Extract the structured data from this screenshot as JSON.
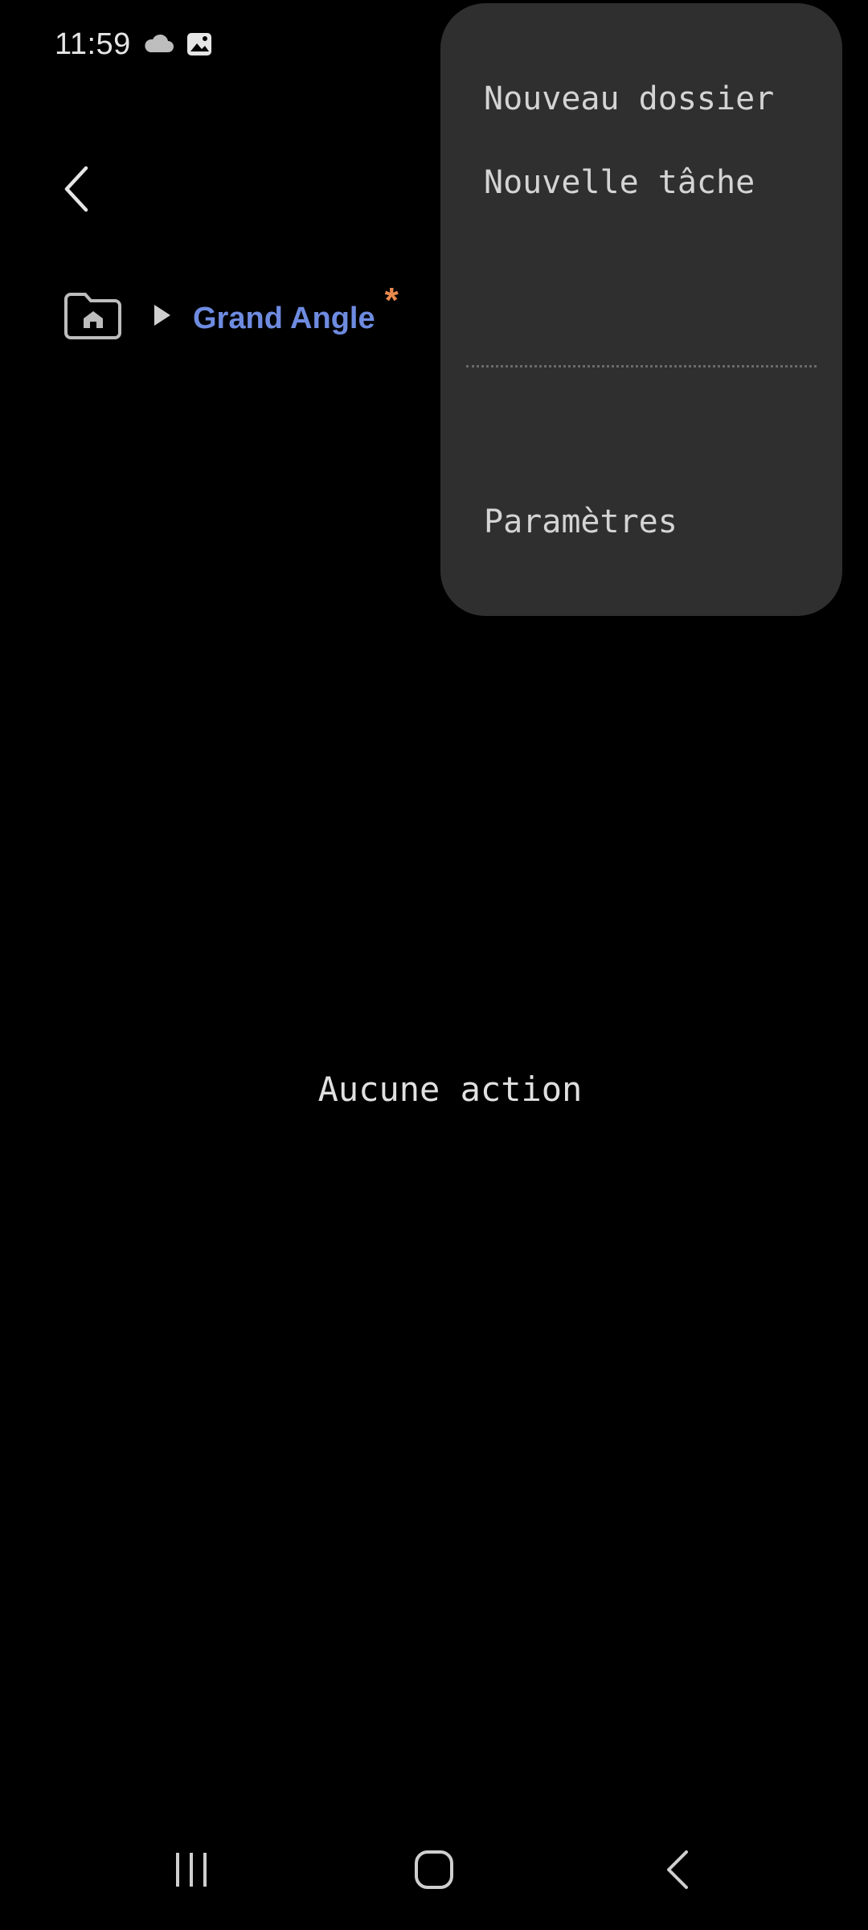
{
  "status_bar": {
    "time": "11:59",
    "icons": [
      "cloud-icon",
      "gallery-icon"
    ]
  },
  "header": {
    "back_icon": "chevron-left-icon"
  },
  "breadcrumb": {
    "home_icon": "home-folder-icon",
    "separator_icon": "play-arrow-icon",
    "current_label": "Grand Angle",
    "modified_marker": "*"
  },
  "main": {
    "empty_message": "Aucune action"
  },
  "menu": {
    "items": [
      {
        "label": "Nouveau dossier"
      },
      {
        "label": "Nouvelle tâche"
      },
      {
        "label": "Paramètres"
      }
    ]
  },
  "nav_bar": {
    "icons": [
      "recents-icon",
      "home-icon",
      "back-icon"
    ]
  },
  "colors": {
    "background": "#000000",
    "menu_background": "#2f2f2f",
    "breadcrumb_label": "#6e8be0",
    "modified_marker": "#e88a4c"
  }
}
